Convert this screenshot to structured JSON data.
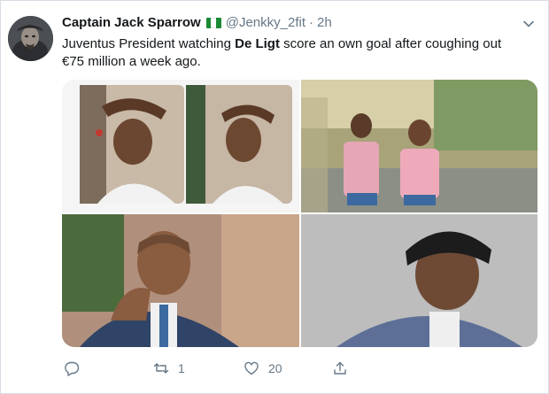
{
  "colors": {
    "name_text": "#14171a",
    "secondary_text": "#657786",
    "flag_green": "#1a8a35",
    "flag_white": "#ffffff",
    "border": "#d6dde3"
  },
  "tweet": {
    "author": {
      "display_name": "Captain Jack Sparrow",
      "flag_icon": "nigeria-flag-icon",
      "handle": "@Jenkky_2fit",
      "separator": "·",
      "time": "2h"
    },
    "text": {
      "part1": "Juventus President watching ",
      "bold": "De Ligt",
      "part2": " score an own goal after coughing out €75 million a week ago."
    },
    "media_count": 4,
    "actions": {
      "reply": {
        "icon": "reply-icon",
        "count": ""
      },
      "retweet": {
        "icon": "retweet-icon",
        "count": "1"
      },
      "like": {
        "icon": "heart-icon",
        "count": "20"
      },
      "share": {
        "icon": "share-icon",
        "count": ""
      }
    },
    "menu_icon": "chevron-down-icon"
  }
}
